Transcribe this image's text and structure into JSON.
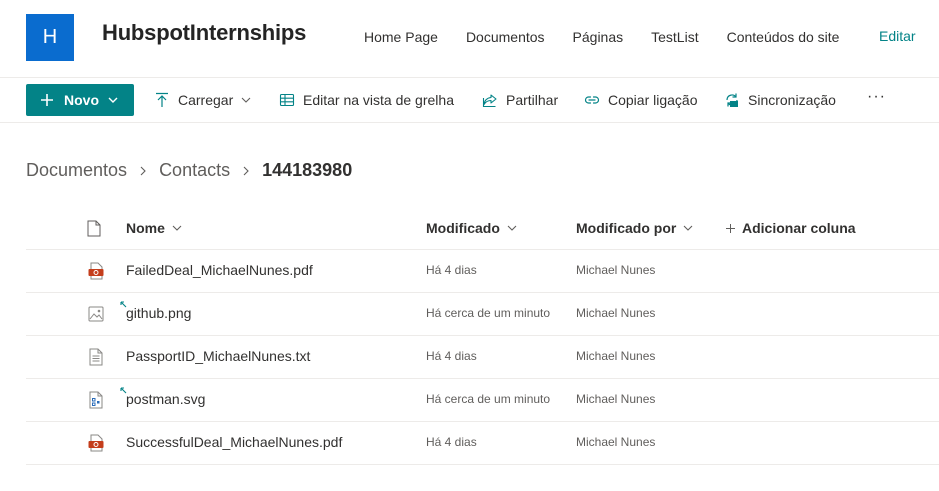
{
  "site": {
    "logo_letter": "H",
    "title": "HubspotInternships",
    "nav": [
      "Home Page",
      "Documentos",
      "Páginas",
      "TestList",
      "Conteúdos do site"
    ],
    "edit_label": "Editar"
  },
  "command_bar": {
    "new_label": "Novo",
    "upload_label": "Carregar",
    "grid_edit_label": "Editar na vista de grelha",
    "share_label": "Partilhar",
    "copy_link_label": "Copiar ligação",
    "sync_label": "Sincronização",
    "more_label": "···"
  },
  "breadcrumb": [
    "Documentos",
    "Contacts",
    "144183980"
  ],
  "list": {
    "columns": {
      "name": "Nome",
      "modified": "Modificado",
      "modified_by": "Modificado por",
      "add_column": "Adicionar coluna"
    },
    "rows": [
      {
        "name": "FailedDeal_MichaelNunes.pdf",
        "modified": "Há 4 dias",
        "modified_by": "Michael Nunes",
        "icon": "pdf-icon",
        "is_new": false
      },
      {
        "name": "github.png",
        "modified": "Há cerca de um minuto",
        "modified_by": "Michael Nunes",
        "icon": "image-icon",
        "is_new": true
      },
      {
        "name": "PassportID_MichaelNunes.txt",
        "modified": "Há 4 dias",
        "modified_by": "Michael Nunes",
        "icon": "text-file-icon",
        "is_new": false
      },
      {
        "name": "postman.svg",
        "modified": "Há cerca de um minuto",
        "modified_by": "Michael Nunes",
        "icon": "vector-file-icon",
        "is_new": true
      },
      {
        "name": "SuccessfulDeal_MichaelNunes.pdf",
        "modified": "Há 4 dias",
        "modified_by": "Michael Nunes",
        "icon": "pdf-icon",
        "is_new": false
      }
    ]
  },
  "colors": {
    "accent": "#038387",
    "logo_bg": "#0a6ccf",
    "pdf_red": "#c43e1c",
    "divider": "#edebe9"
  }
}
